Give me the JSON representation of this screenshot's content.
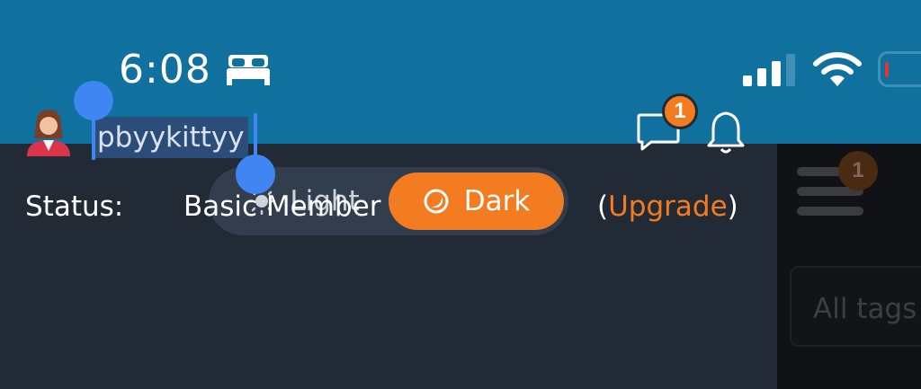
{
  "status_bar": {
    "time": "6:08",
    "sleep_icon": "bed-icon",
    "signal_icon": "cellular-signal-icon",
    "wifi_icon": "wifi-icon",
    "battery_icon": "battery-low-icon",
    "battery_level_percent": 5,
    "background": "#10719f"
  },
  "theme_toggle": {
    "light_label": "Light",
    "dark_label": "Dark",
    "selected": "Dark",
    "accent": "#f37b20"
  },
  "user": {
    "avatar_icon": "user-avatar-icon",
    "username": "pbyykittyy"
  },
  "notifications": {
    "chat_icon": "chat-bubble-icon",
    "chat_count": "1",
    "bell_icon": "bell-icon"
  },
  "membership": {
    "status_label": "Status:",
    "status_value": "Basic Member",
    "open_paren": "(",
    "upgrade_label": "Upgrade",
    "close_paren": ")"
  },
  "background_page": {
    "menu_badge": "1",
    "tags_placeholder": "All tags"
  }
}
